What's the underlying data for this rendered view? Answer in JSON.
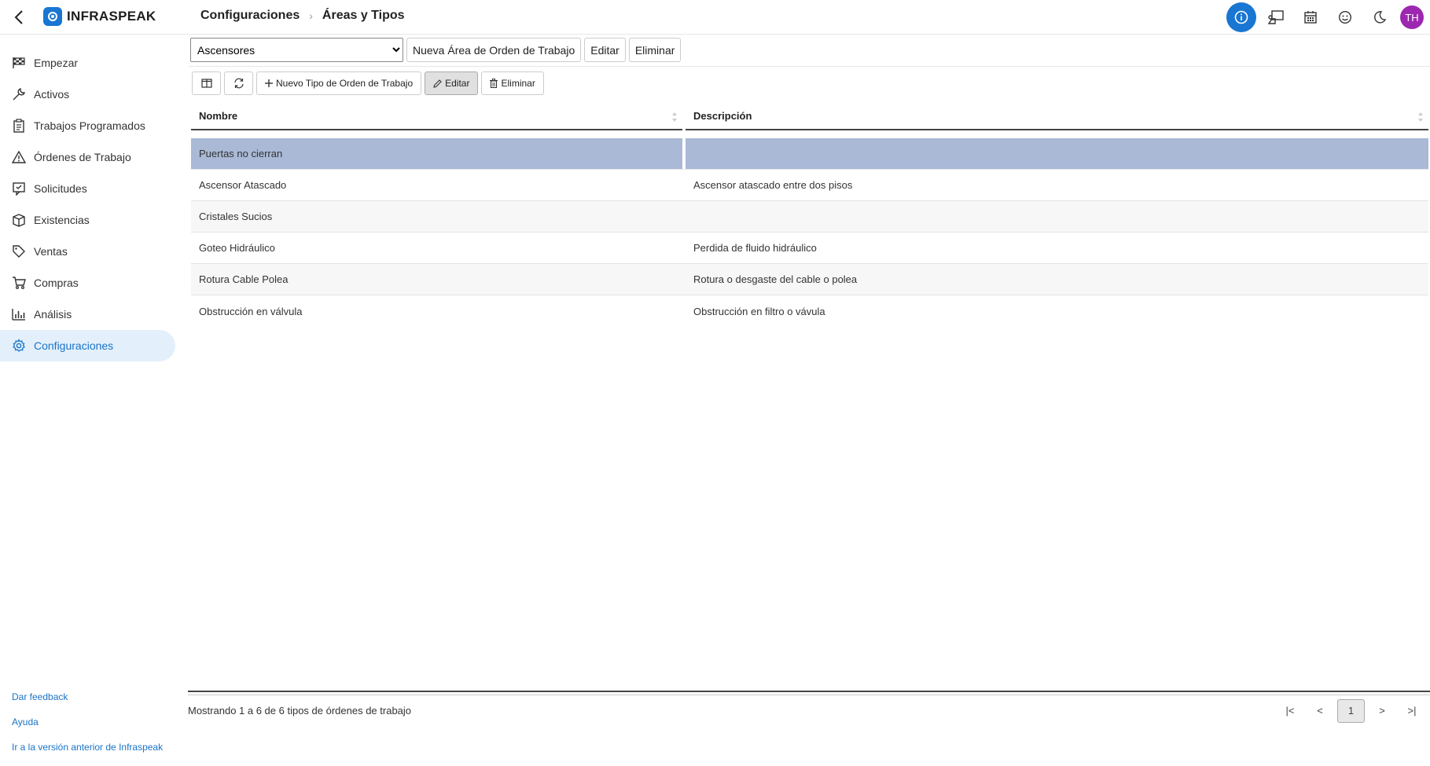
{
  "app": {
    "brand": "INFRASPEAK"
  },
  "breadcrumb": {
    "parent": "Configuraciones",
    "current": "Áreas y Tipos"
  },
  "header": {
    "avatar_initials": "TH",
    "accent_color": "#1976d2",
    "avatar_color": "#9c27b0",
    "icons": [
      "info-icon",
      "assets-icon",
      "calendar-icon",
      "smiley-icon",
      "moon-icon"
    ]
  },
  "sidebar": {
    "items": [
      {
        "label": "Empezar",
        "icon": "checkered-flag-icon"
      },
      {
        "label": "Activos",
        "icon": "wrench-icon"
      },
      {
        "label": "Trabajos Programados",
        "icon": "clipboard-icon"
      },
      {
        "label": "Órdenes de Trabajo",
        "icon": "warning-icon"
      },
      {
        "label": "Solicitudes",
        "icon": "request-icon"
      },
      {
        "label": "Existencias",
        "icon": "box-icon"
      },
      {
        "label": "Ventas",
        "icon": "tag-icon"
      },
      {
        "label": "Compras",
        "icon": "cart-icon"
      },
      {
        "label": "Análisis",
        "icon": "bar-chart-icon"
      },
      {
        "label": "Configuraciones",
        "icon": "gear-icon",
        "active": true
      }
    ],
    "links": {
      "feedback": "Dar feedback",
      "help": "Ayuda",
      "old_version": "Ir a la versión anterior de Infraspeak"
    }
  },
  "area_toolbar": {
    "selected_area": "Ascensores",
    "new_area_label": "Nueva Área de Orden de Trabajo",
    "edit_label": "Editar",
    "delete_label": "Eliminar"
  },
  "type_toolbar": {
    "new_type_label": "Nuevo Tipo de Orden de Trabajo",
    "edit_label": "Editar",
    "delete_label": "Eliminar"
  },
  "table": {
    "columns": [
      "Nombre",
      "Descripción"
    ],
    "rows": [
      {
        "name": "Puertas no cierran",
        "description": "",
        "selected": true
      },
      {
        "name": "Ascensor Atascado",
        "description": "Ascensor atascado entre dos pisos"
      },
      {
        "name": "Cristales Sucios",
        "description": ""
      },
      {
        "name": "Goteo Hidráulico",
        "description": "Perdida de fluido hidráulico"
      },
      {
        "name": "Rotura Cable Polea",
        "description": "Rotura o desgaste del cable o polea"
      },
      {
        "name": "Obstrucción en válvula",
        "description": "Obstrucción en filtro o vávula"
      }
    ]
  },
  "footer": {
    "summary": "Mostrando 1 a 6 de 6 tipos de órdenes de trabajo",
    "pager": {
      "first": "|<",
      "prev": "<",
      "current_page": "1",
      "next": ">",
      "last": ">|"
    }
  }
}
